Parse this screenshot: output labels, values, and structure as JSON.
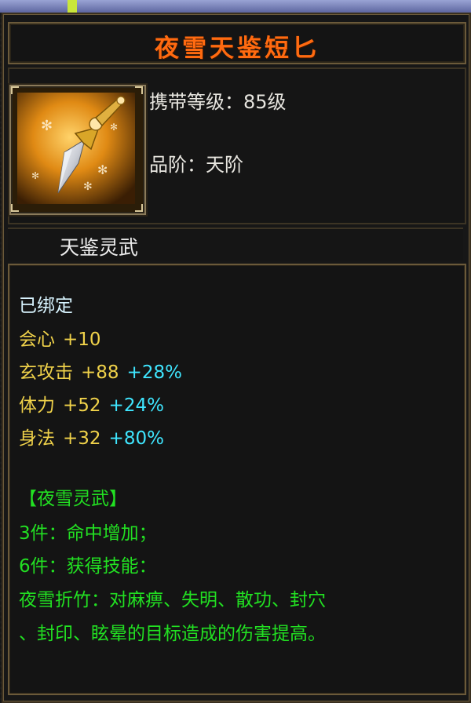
{
  "item": {
    "name": "夜雪天鉴短匕",
    "carry_level": "携带等级：85级",
    "grade": "品阶：天阶",
    "category": "天鉴灵武",
    "bound": "已绑定",
    "stats": [
      {
        "name": "会心",
        "value": "+10",
        "percent": ""
      },
      {
        "name": "玄攻击",
        "value": "+88",
        "percent": "+28%"
      },
      {
        "name": "体力",
        "value": "+52",
        "percent": "+24%"
      },
      {
        "name": "身法",
        "value": "+32",
        "percent": "+80%"
      }
    ],
    "set_title": "【夜雪灵武】",
    "set_bonuses": [
      "3件：命中增加；",
      "6件：获得技能：",
      "夜雪折竹：对麻痹、失明、散功、封穴",
      "、封印、眩晕的目标造成的伤害提高。"
    ]
  },
  "icon": {
    "name": "dagger-icon"
  },
  "colors": {
    "title": "#ff6a10",
    "stat_name": "#f0d24a",
    "percent": "#3fe6ff",
    "set": "#22e022",
    "bound": "#d8f4ff"
  }
}
